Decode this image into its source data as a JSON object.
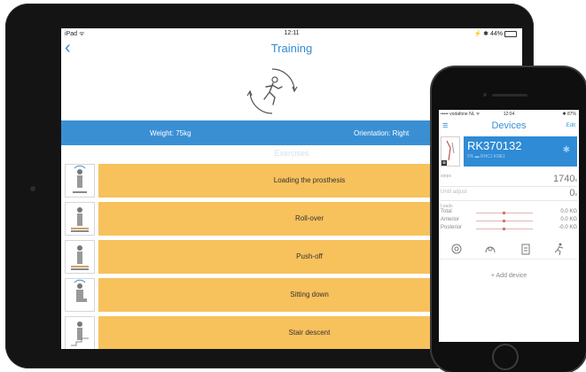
{
  "ipad": {
    "status": {
      "left": "iPad ᯤ",
      "time": "12:11",
      "right": "⚡ ✱ 44%"
    },
    "nav": {
      "back_icon": "‹",
      "title": "Training"
    },
    "info": {
      "weight": "Weight: 75kg",
      "orientation": "Orientation: Right"
    },
    "exercises_header": "Exercises",
    "exercises": [
      {
        "label": "Loading the prosthesis"
      },
      {
        "label": "Roll-over"
      },
      {
        "label": "Push-off"
      },
      {
        "label": "Sitting down"
      },
      {
        "label": "Stair descent"
      }
    ],
    "colors": {
      "accent": "#2f8bd6",
      "info_bar": "#3a8fd3",
      "exercise": "#f7c15c"
    }
  },
  "iphone": {
    "status": {
      "left": "••••• vodafone NL ᯤ",
      "time": "12:04",
      "right": "✱ 87%"
    },
    "nav": {
      "menu_icon": "≡",
      "title": "Devices",
      "edit": "Edit"
    },
    "device": {
      "id": "RK370132",
      "sub": "5% ▬ RHC1 KNE1",
      "bt_icon": "✱"
    },
    "steps": {
      "label": "steps",
      "value": "1740",
      "unit": "s"
    },
    "until": {
      "label": "Until adjust",
      "value": "0",
      "unit": "s"
    },
    "loads": {
      "label": "Loads",
      "rows": [
        {
          "name": "Total",
          "value": "0.0 KG"
        },
        {
          "name": "Anterior",
          "value": "0.0 KG"
        },
        {
          "name": "Posterior",
          "value": "-0.0 KG"
        }
      ]
    },
    "add_device": "+ Add device"
  }
}
